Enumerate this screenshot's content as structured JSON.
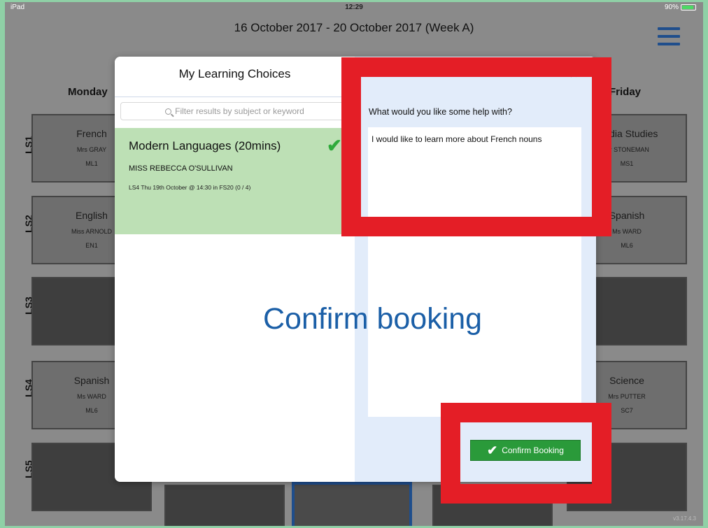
{
  "status_bar": {
    "device": "iPad",
    "wifi_icon": "wifi-icon",
    "time": "12:29",
    "battery_percent": 90,
    "battery_text": "90%"
  },
  "header": {
    "week": "16 October 2017 - 20 October 2017 (Week A)",
    "menu_icon": "hamburger-menu-icon"
  },
  "days": [
    "Monday",
    "Friday"
  ],
  "periods": [
    "LS1",
    "LS2",
    "LS3",
    "LS4",
    "LS5"
  ],
  "monday": [
    {
      "subject": "French",
      "teacher": "Mrs GRAY",
      "room": "ML1"
    },
    {
      "subject": "English",
      "teacher": "Miss ARNOLD",
      "room": "EN1"
    },
    {
      "subject": "",
      "teacher": "",
      "room": ""
    },
    {
      "subject": "Spanish",
      "teacher": "Ms WARD",
      "room": "ML6"
    },
    {
      "subject": "",
      "teacher": "",
      "room": ""
    }
  ],
  "friday": [
    {
      "subject": "Media Studies",
      "teacher": "Mr STONEMAN",
      "room": "MS1"
    },
    {
      "subject": "Spanish",
      "teacher": "Ms WARD",
      "room": "ML6"
    },
    {
      "subject": "",
      "teacher": "",
      "room": ""
    },
    {
      "subject": "Science",
      "teacher": "Mrs PUTTER",
      "room": "SC7"
    },
    {
      "subject": "",
      "teacher": "",
      "room": ""
    }
  ],
  "modal": {
    "title": "My Learning Choices",
    "filter_placeholder": "Filter results by subject or keyword",
    "choice": {
      "title": "Modern Languages (20mins)",
      "teacher": "MISS REBECCA O'SULLIVAN",
      "detail": "LS4 Thu 19th October @ 14:30 in FS20 (0 / 4)"
    },
    "help_label": "What would you like some help with?",
    "help_text": "I would like to learn more about French nouns",
    "confirm_label": "Confirm Booking",
    "close_glyph": "×"
  },
  "overlay": {
    "caption": "Confirm booking",
    "highlight_color": "#e41e26"
  },
  "version": "v3.17.4.3"
}
